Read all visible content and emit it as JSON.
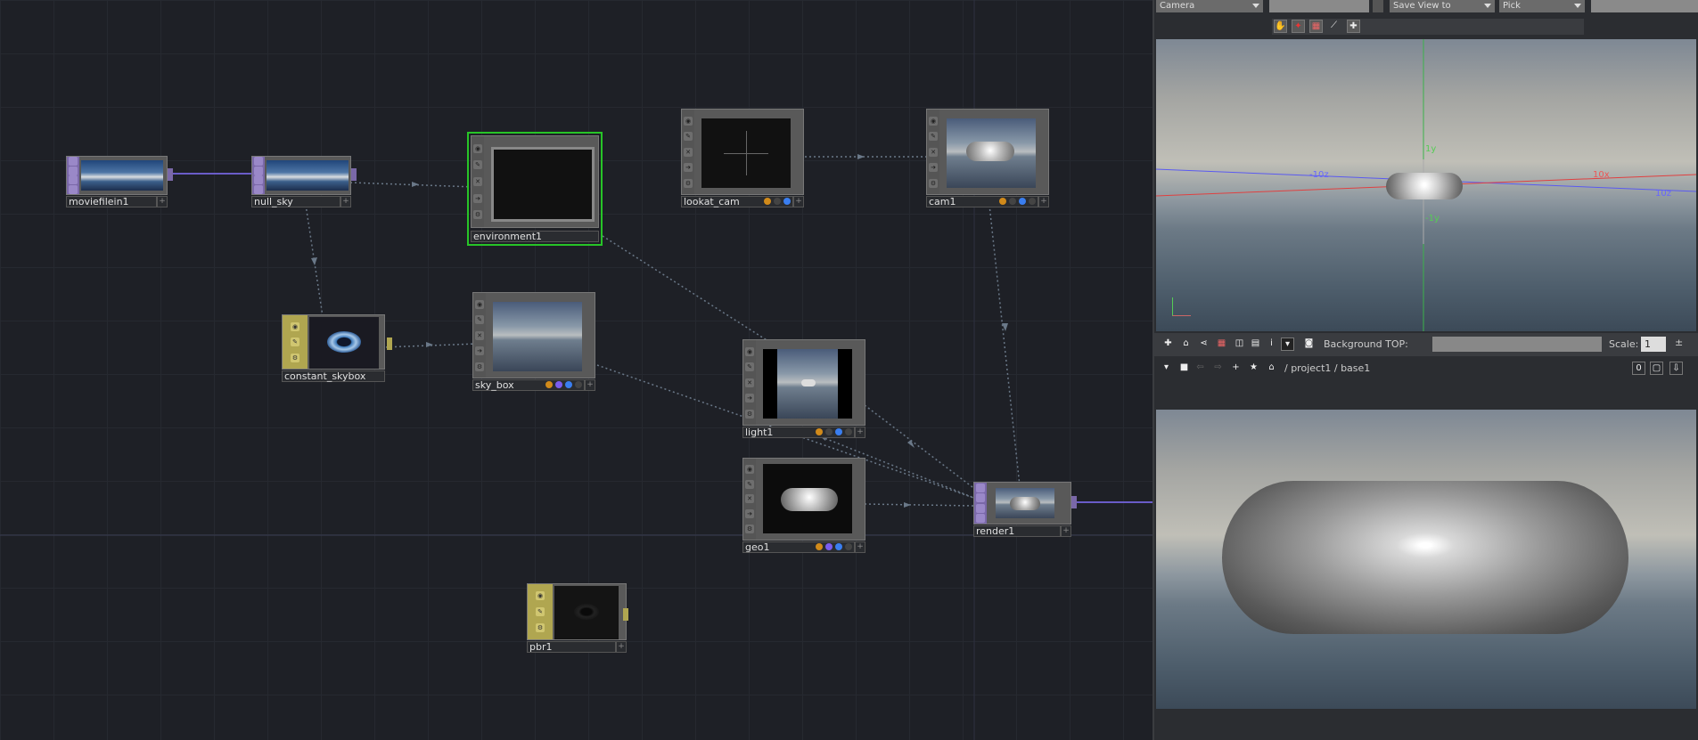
{
  "network": {
    "nodes": [
      {
        "id": "moviefilein1",
        "label": "moviefilein1"
      },
      {
        "id": "null_sky",
        "label": "null_sky"
      },
      {
        "id": "environment1",
        "label": "environment1"
      },
      {
        "id": "lookat_cam",
        "label": "lookat_cam"
      },
      {
        "id": "cam1",
        "label": "cam1"
      },
      {
        "id": "constant_skybox",
        "label": "constant_skybox"
      },
      {
        "id": "sky_box",
        "label": "sky_box"
      },
      {
        "id": "light1",
        "label": "light1"
      },
      {
        "id": "geo1",
        "label": "geo1"
      },
      {
        "id": "render1",
        "label": "render1"
      },
      {
        "id": "pbr1",
        "label": "pbr1"
      }
    ]
  },
  "viewer": {
    "camera_dropdown": "Camera",
    "saveview_dropdown": "Save View to",
    "pick_dropdown": "Pick",
    "toolbar_icons": [
      "hand-icon",
      "select-icon",
      "grid-icon",
      "bone-icon",
      "add-icon"
    ],
    "axis_labels": {
      "y_top": "1y",
      "y_bottom": "-1y",
      "neg_z": "-10z",
      "pos_x": "10x",
      "pos_z": "10z"
    },
    "bottom_toolbar": {
      "background_top_label": "Background TOP:",
      "background_top_value": "",
      "scale_label": "Scale:",
      "scale_value": "1"
    }
  },
  "pathbar": {
    "path": "/ project1 / base1",
    "counter": "0"
  },
  "colors": {
    "accent_green": "#27c427",
    "purple_op": "#7a68a8",
    "yellow_op": "#b0a650",
    "wire": "#6a7888",
    "wire_purple": "#6a5cc8"
  }
}
